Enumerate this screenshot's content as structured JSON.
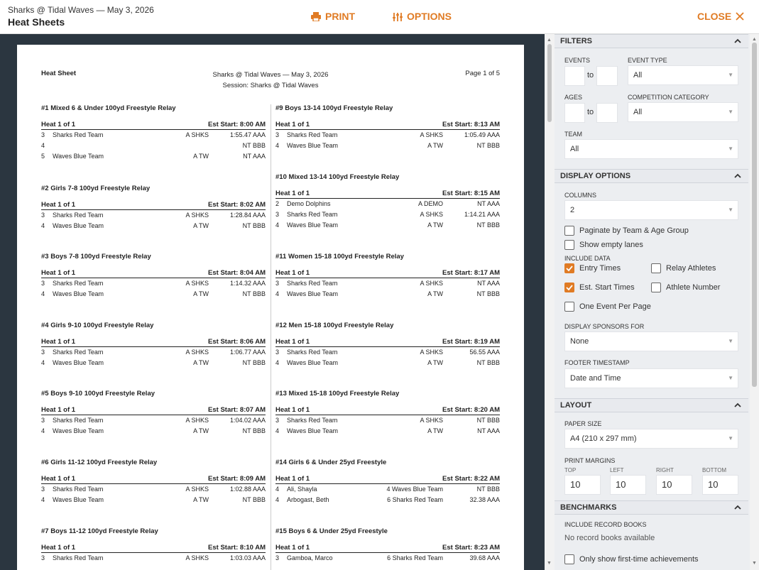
{
  "header": {
    "subtitle": "Sharks @ Tidal Waves — May 3, 2026",
    "title": "Heat Sheets",
    "print_label": "PRINT",
    "options_label": "OPTIONS",
    "close_label": "CLOSE",
    "accent": "#e07b24"
  },
  "sheet": {
    "left_title": "Heat Sheet",
    "center_line1": "Sharks @ Tidal Waves — May 3, 2026",
    "center_line2": "Session: Sharks @ Tidal Waves",
    "page_label": "Page 1 of 5"
  },
  "events_left": [
    {
      "title": "#1 Mixed 6 & Under 100yd Freestyle Relay",
      "heat": "Heat 1 of 1",
      "start": "Est Start: 8:00 AM",
      "lanes": [
        {
          "lane": "3",
          "name": "Sharks Red Team",
          "team": "A SHKS",
          "time": "1:55.47 AAA"
        },
        {
          "lane": "4",
          "name": "",
          "team": "",
          "time": "NT BBB"
        },
        {
          "lane": "5",
          "name": "Waves Blue Team",
          "team": "A TW",
          "time": "NT AAA"
        }
      ]
    },
    {
      "title": "#2 Girls 7-8 100yd Freestyle Relay",
      "heat": "Heat 1 of 1",
      "start": "Est Start: 8:02 AM",
      "lanes": [
        {
          "lane": "3",
          "name": "Sharks Red Team",
          "team": "A SHKS",
          "time": "1:28.84 AAA"
        },
        {
          "lane": "4",
          "name": "Waves Blue Team",
          "team": "A TW",
          "time": "NT BBB"
        }
      ]
    },
    {
      "title": "#3 Boys 7-8 100yd Freestyle Relay",
      "heat": "Heat 1 of 1",
      "start": "Est Start: 8:04 AM",
      "lanes": [
        {
          "lane": "3",
          "name": "Sharks Red Team",
          "team": "A SHKS",
          "time": "1:14.32 AAA"
        },
        {
          "lane": "4",
          "name": "Waves Blue Team",
          "team": "A TW",
          "time": "NT BBB"
        }
      ]
    },
    {
      "title": "#4 Girls 9-10 100yd Freestyle Relay",
      "heat": "Heat 1 of 1",
      "start": "Est Start: 8:06 AM",
      "lanes": [
        {
          "lane": "3",
          "name": "Sharks Red Team",
          "team": "A SHKS",
          "time": "1:06.77 AAA"
        },
        {
          "lane": "4",
          "name": "Waves Blue Team",
          "team": "A TW",
          "time": "NT BBB"
        }
      ]
    },
    {
      "title": "#5 Boys 9-10 100yd Freestyle Relay",
      "heat": "Heat 1 of 1",
      "start": "Est Start: 8:07 AM",
      "lanes": [
        {
          "lane": "3",
          "name": "Sharks Red Team",
          "team": "A SHKS",
          "time": "1:04.02 AAA"
        },
        {
          "lane": "4",
          "name": "Waves Blue Team",
          "team": "A TW",
          "time": "NT BBB"
        }
      ]
    },
    {
      "title": "#6 Girls 11-12 100yd Freestyle Relay",
      "heat": "Heat 1 of 1",
      "start": "Est Start: 8:09 AM",
      "lanes": [
        {
          "lane": "3",
          "name": "Sharks Red Team",
          "team": "A SHKS",
          "time": "1:02.88 AAA"
        },
        {
          "lane": "4",
          "name": "Waves Blue Team",
          "team": "A TW",
          "time": "NT BBB"
        }
      ]
    },
    {
      "title": "#7 Boys 11-12 100yd Freestyle Relay",
      "heat": "Heat 1 of 1",
      "start": "Est Start: 8:10 AM",
      "lanes": [
        {
          "lane": "3",
          "name": "Sharks Red Team",
          "team": "A SHKS",
          "time": "1:03.03 AAA"
        }
      ]
    }
  ],
  "events_right": [
    {
      "title": "#9 Boys 13-14 100yd Freestyle Relay",
      "heat": "Heat 1 of 1",
      "start": "Est Start: 8:13 AM",
      "lanes": [
        {
          "lane": "3",
          "name": "Sharks Red Team",
          "team": "A SHKS",
          "time": "1:05.49 AAA"
        },
        {
          "lane": "4",
          "name": "Waves Blue Team",
          "team": "A TW",
          "time": "NT BBB"
        }
      ]
    },
    {
      "title": "#10 Mixed 13-14 100yd Freestyle Relay",
      "heat": "Heat 1 of 1",
      "start": "Est Start: 8:15 AM",
      "lanes": [
        {
          "lane": "2",
          "name": "Demo Dolphins",
          "team": "A DEMO",
          "time": "NT AAA"
        },
        {
          "lane": "3",
          "name": "Sharks Red Team",
          "team": "A SHKS",
          "time": "1:14.21 AAA"
        },
        {
          "lane": "4",
          "name": "Waves Blue Team",
          "team": "A TW",
          "time": "NT BBB"
        }
      ]
    },
    {
      "title": "#11 Women 15-18 100yd Freestyle Relay",
      "heat": "Heat 1 of 1",
      "start": "Est Start: 8:17 AM",
      "lanes": [
        {
          "lane": "3",
          "name": "Sharks Red Team",
          "team": "A SHKS",
          "time": "NT AAA"
        },
        {
          "lane": "4",
          "name": "Waves Blue Team",
          "team": "A TW",
          "time": "NT BBB"
        }
      ]
    },
    {
      "title": "#12 Men 15-18 100yd Freestyle Relay",
      "heat": "Heat 1 of 1",
      "start": "Est Start: 8:19 AM",
      "lanes": [
        {
          "lane": "3",
          "name": "Sharks Red Team",
          "team": "A SHKS",
          "time": "56.55 AAA"
        },
        {
          "lane": "4",
          "name": "Waves Blue Team",
          "team": "A TW",
          "time": "NT BBB"
        }
      ]
    },
    {
      "title": "#13 Mixed 15-18 100yd Freestyle Relay",
      "heat": "Heat 1 of 1",
      "start": "Est Start: 8:20 AM",
      "lanes": [
        {
          "lane": "3",
          "name": "Sharks Red Team",
          "team": "A SHKS",
          "time": "NT BBB"
        },
        {
          "lane": "4",
          "name": "Waves Blue Team",
          "team": "A TW",
          "time": "NT AAA"
        }
      ]
    },
    {
      "title": "#14 Girls 6 & Under 25yd Freestyle",
      "heat": "Heat 1 of 1",
      "start": "Est Start: 8:22 AM",
      "lanes": [
        {
          "lane": "4",
          "name": "Ali, Shayla",
          "team": "4 Waves Blue Team",
          "time": "NT BBB"
        },
        {
          "lane": "4",
          "name": "Arbogast, Beth",
          "team": "6 Sharks Red Team",
          "time": "32.38 AAA"
        }
      ]
    },
    {
      "title": "#15 Boys 6 & Under 25yd Freestyle",
      "heat": "Heat 1 of 1",
      "start": "Est Start: 8:23 AM",
      "lanes": [
        {
          "lane": "3",
          "name": "Gamboa, Marco",
          "team": "6 Sharks Red Team",
          "time": "39.68 AAA"
        }
      ]
    }
  ],
  "filters": {
    "section": "FILTERS",
    "events_label": "EVENTS",
    "to_label": "to",
    "event_type_label": "EVENT TYPE",
    "event_type_value": "All",
    "ages_label": "AGES",
    "competition_category_label": "COMPETITION CATEGORY",
    "competition_category_value": "All",
    "team_label": "TEAM",
    "team_value": "All"
  },
  "display": {
    "section": "DISPLAY OPTIONS",
    "columns_label": "COLUMNS",
    "columns_value": "2",
    "paginate_label": "Paginate by Team & Age Group",
    "empty_lanes_label": "Show empty lanes",
    "include_data_label": "INCLUDE DATA",
    "entry_times_label": "Entry Times",
    "relay_athletes_label": "Relay Athletes",
    "est_start_label": "Est. Start Times",
    "athlete_number_label": "Athlete Number",
    "one_event_label": "One Event Per Page",
    "sponsors_label": "DISPLAY SPONSORS FOR",
    "sponsors_value": "None",
    "footer_label": "FOOTER TIMESTAMP",
    "footer_value": "Date and Time"
  },
  "layout": {
    "section": "LAYOUT",
    "paper_label": "PAPER SIZE",
    "paper_value": "A4 (210 x 297 mm)",
    "margins_label": "PRINT MARGINS",
    "top_label": "TOP",
    "left_label": "LEFT",
    "right_label": "RIGHT",
    "bottom_label": "BOTTOM",
    "top_value": "10",
    "left_value": "10",
    "right_value": "10",
    "bottom_value": "10"
  },
  "benchmarks": {
    "section": "BENCHMARKS",
    "record_books_label": "INCLUDE RECORD BOOKS",
    "no_records": "No record books available",
    "first_time_label": "Only show first-time achievements"
  }
}
